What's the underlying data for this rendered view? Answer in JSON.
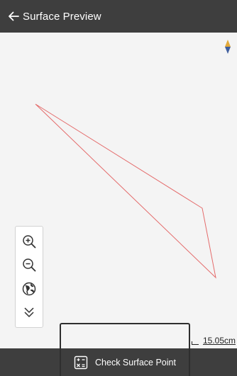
{
  "header": {
    "title": "Surface Preview",
    "back_icon": "arrow-left-icon"
  },
  "map": {
    "compass_icon": "north-compass-icon",
    "polygon_color": "#e46b6b",
    "scale_label": "15.05cm"
  },
  "toolbar": {
    "zoom_in_icon": "zoom-in-icon",
    "zoom_out_icon": "zoom-out-icon",
    "globe_icon": "globe-icon",
    "collapse_icon": "chevron-double-down-icon"
  },
  "footer": {
    "check_label": "Check Surface Point",
    "check_icon": "calculator-icon"
  },
  "colors": {
    "bar_bg": "#3e3e3e",
    "map_bg": "#f4f4f4",
    "compass_north": "#e2a93b",
    "compass_south": "#3f5f9f"
  }
}
